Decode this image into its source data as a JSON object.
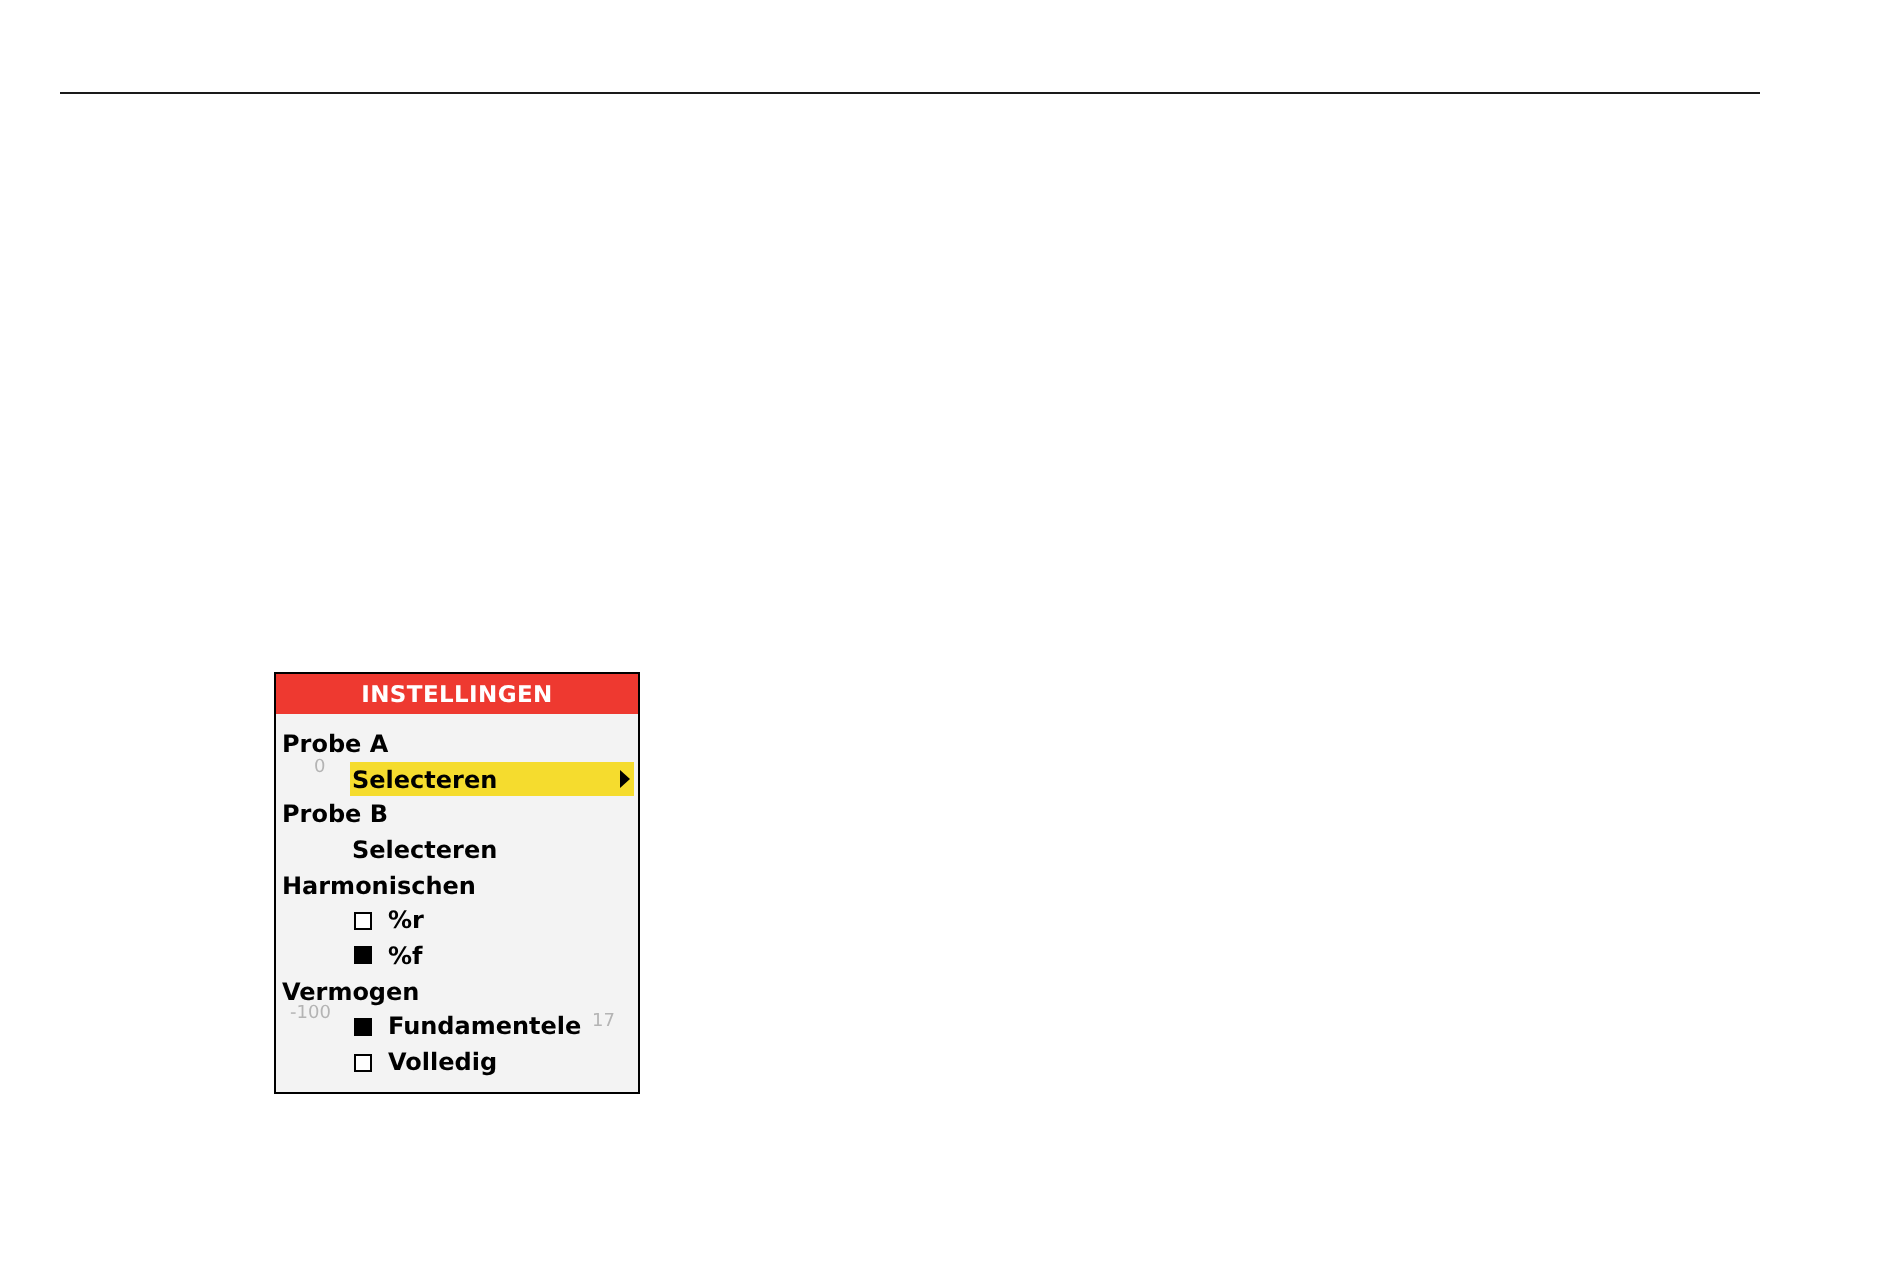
{
  "menu": {
    "title": "INSTELLINGEN",
    "items": [
      {
        "kind": "heading",
        "label": "Probe A"
      },
      {
        "kind": "action",
        "label": "Selecteren",
        "selected": true
      },
      {
        "kind": "heading",
        "label": "Probe B"
      },
      {
        "kind": "action",
        "label": "Selecteren",
        "selected": false
      },
      {
        "kind": "heading",
        "label": "Harmonischen"
      },
      {
        "kind": "checkbox",
        "label": "%r",
        "checked": false,
        "selected": false
      },
      {
        "kind": "checkbox",
        "label": "%f",
        "checked": true,
        "selected": false
      },
      {
        "kind": "heading",
        "label": "Vermogen"
      },
      {
        "kind": "checkbox",
        "label": "Fundamentele",
        "checked": true,
        "selected": false
      },
      {
        "kind": "checkbox",
        "label": "Volledig",
        "checked": false,
        "selected": false
      }
    ]
  },
  "background_labels": [
    "0",
    "-100",
    "17"
  ]
}
